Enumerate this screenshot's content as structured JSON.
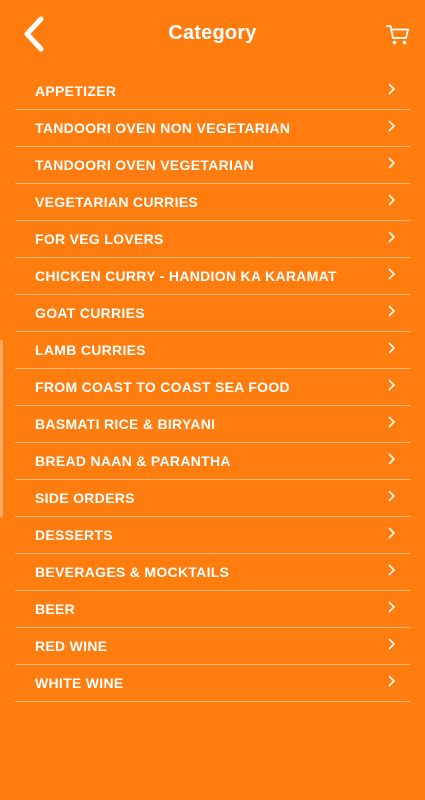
{
  "header": {
    "title": "Category"
  },
  "icons": {
    "back": "chevron-left-icon",
    "cart": "cart-icon",
    "item_chevron": "chevron-right-icon"
  },
  "colors": {
    "background": "#ff7d0f",
    "text": "#ffffff"
  },
  "categories": [
    {
      "label": "APPETIZER"
    },
    {
      "label": "TANDOORI OVEN NON VEGETARIAN"
    },
    {
      "label": "TANDOORI OVEN VEGETARIAN"
    },
    {
      "label": "VEGETARIAN CURRIES"
    },
    {
      "label": "FOR VEG LOVERS"
    },
    {
      "label": "CHICKEN CURRY - HANDION KA KARAMAT"
    },
    {
      "label": "GOAT CURRIES"
    },
    {
      "label": "LAMB CURRIES"
    },
    {
      "label": "FROM COAST TO COAST SEA FOOD"
    },
    {
      "label": "BASMATI RICE & BIRYANI"
    },
    {
      "label": "BREAD NAAN & PARANTHA"
    },
    {
      "label": "SIDE ORDERS"
    },
    {
      "label": "DESSERTS"
    },
    {
      "label": "BEVERAGES & MOCKTAILS"
    },
    {
      "label": "BEER"
    },
    {
      "label": "RED WINE"
    },
    {
      "label": "WHITE WINE"
    }
  ]
}
